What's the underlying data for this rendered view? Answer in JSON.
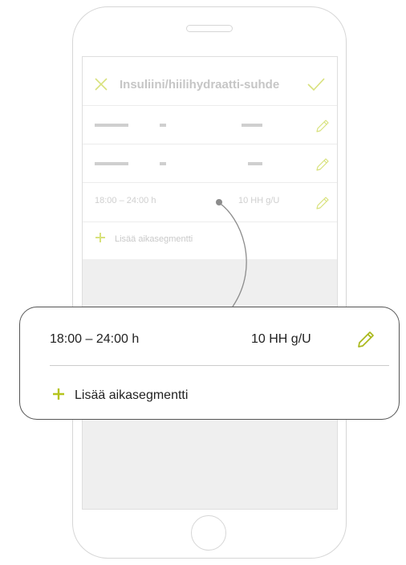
{
  "header": {
    "title": "Insuliini/hiilihydraatti-suhde"
  },
  "segments": [
    {
      "time": "",
      "ratio": "",
      "placeholder": true
    },
    {
      "time": "",
      "ratio": "",
      "placeholder": true
    },
    {
      "time": "18:00 – 24:00 h",
      "ratio": "10 HH g/U",
      "placeholder": false
    }
  ],
  "add_segment": {
    "label": "Lisää aikasegmentti"
  },
  "zoom": {
    "time": "18:00 – 24:00 h",
    "ratio": "10 HH g/U",
    "add_label": "Lisää aikasegmentti"
  },
  "colors": {
    "accent": "#b5c41e",
    "accent_light": "#d8e17c",
    "muted_text": "#c6c6c6"
  },
  "icons": {
    "close": "x-icon",
    "confirm": "check-icon",
    "edit": "pencil-icon",
    "add": "plus-icon"
  }
}
